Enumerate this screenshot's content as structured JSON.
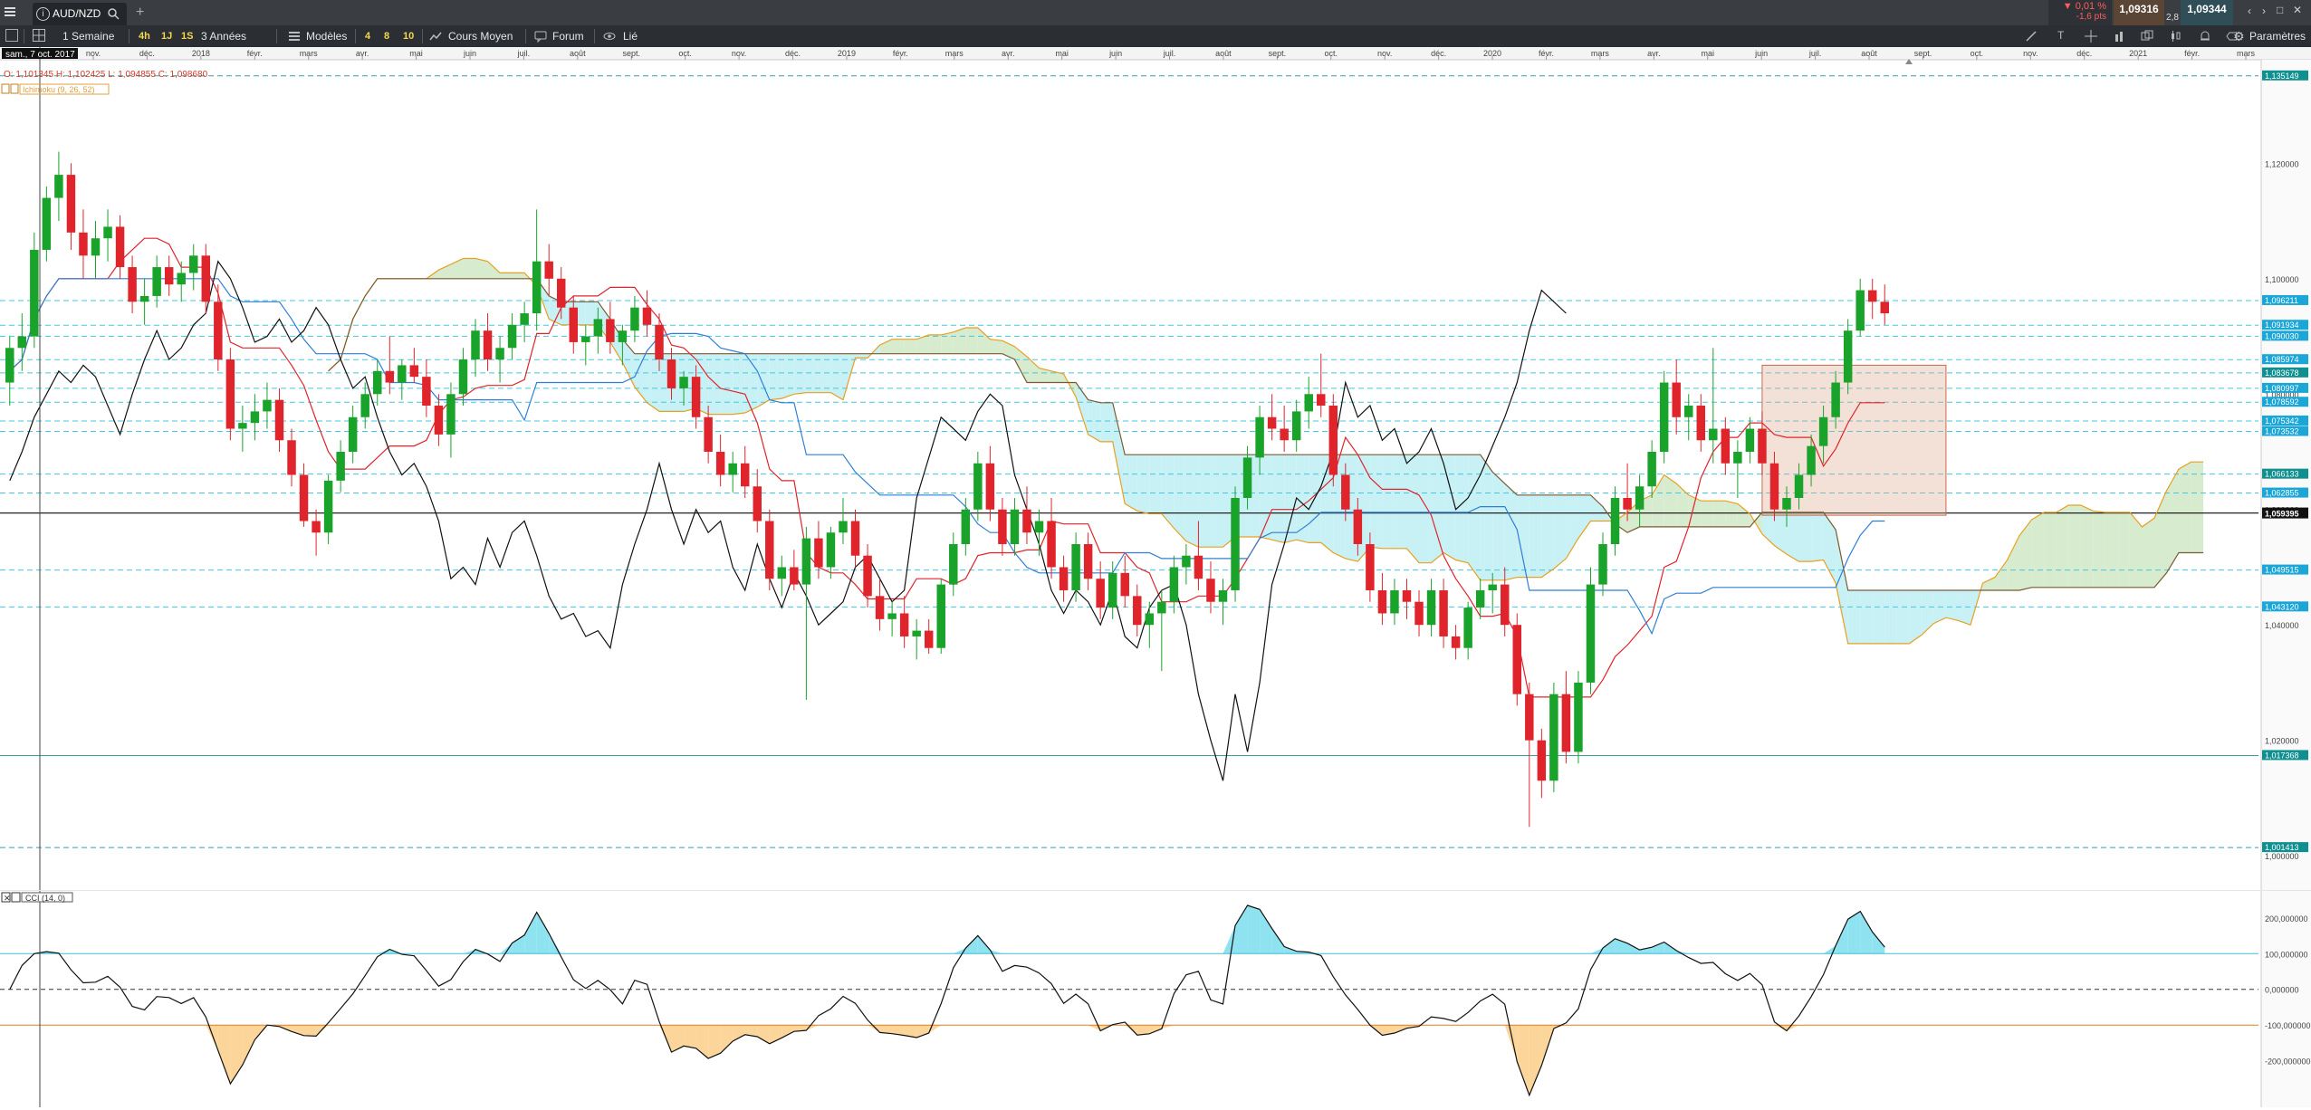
{
  "top_bar": {
    "symbol": "AUD/NZD",
    "new_tab": "+",
    "change_pct": "▼ 0,01 %",
    "change_pts": "-1,6 pts",
    "bid": "1,09316",
    "spread": "2,8",
    "ask": "1,09344",
    "window_controls": [
      "‹",
      "›",
      "□",
      "✕"
    ]
  },
  "toolbar": {
    "period": "1 Semaine",
    "quick_ranges": [
      "4h",
      "1J",
      "1S"
    ],
    "range": "3 Années",
    "models": "Modèles",
    "presets": [
      "4",
      "8",
      "10"
    ],
    "price_mode": "Cours Moyen",
    "forum": "Forum",
    "linked": "Lié",
    "settings": "Paramètres"
  },
  "time_axis": {
    "cursor_date": "sam., 7 oct. 2017",
    "labels": [
      "nov.",
      "déc.",
      "2018",
      "févr.",
      "mars",
      "avr.",
      "mai",
      "juin",
      "juil.",
      "août",
      "sept.",
      "oct.",
      "nov.",
      "déc.",
      "2019",
      "févr.",
      "mars",
      "avr.",
      "mai",
      "juin",
      "juil.",
      "août",
      "sept.",
      "oct.",
      "nov.",
      "déc.",
      "2020",
      "févr.",
      "mars",
      "avr.",
      "mai",
      "juin",
      "juil.",
      "août",
      "sept.",
      "oct.",
      "nov.",
      "déc.",
      "2021",
      "févr.",
      "mars"
    ]
  },
  "legend": {
    "ohlc": "O: 1,101345  H: 1,102425  L: 1,094855  C: 1,098680",
    "indicator": "Ichimoku (9, 26, 52)",
    "oscillator": "CCI (14, 0)"
  },
  "price_axis": {
    "ticks": [
      "1,120000",
      "1,100000",
      "1,080000",
      "1,060000",
      "1,040000",
      "1,020000",
      "1,000000"
    ],
    "current_price": "1,059395",
    "level_tags": [
      "1,135149",
      "1,096211",
      "1,091934",
      "1,090030",
      "1,085974",
      "1,083678",
      "1,080997",
      "1,078592",
      "1,075342",
      "1,073532",
      "1,066133",
      "1,062855",
      "1,049515",
      "1,043120",
      "1,017368",
      "1,001413"
    ],
    "level_tag_colors": [
      "#0f8f8f",
      "#1ba6d8",
      "#1ba6d8",
      "#1ba6d8",
      "#1ba6d8",
      "#0f8f8f",
      "#1ba6d8",
      "#1ba6d8",
      "#1ba6d8",
      "#1ba6d8",
      "#0f8f8f",
      "#1ba6d8",
      "#1ba6d8",
      "#1ba6d8",
      "#0f8f8f",
      "#0f8f8f"
    ]
  },
  "cci_axis": {
    "ticks": [
      "200,000000",
      "100,000000",
      "0,000000",
      "-100,000000",
      "-200,000000"
    ]
  },
  "chart_data": {
    "type": "candlestick",
    "symbol": "AUD/NZD",
    "interval": "1 Semaine",
    "ylim": [
      0.995,
      1.137
    ],
    "up_color": "#1aa32a",
    "down_color": "#e0242c",
    "candles": [
      [
        1.082,
        1.09,
        1.078,
        1.088
      ],
      [
        1.088,
        1.094,
        1.084,
        1.09
      ],
      [
        1.09,
        1.108,
        1.088,
        1.105
      ],
      [
        1.105,
        1.116,
        1.103,
        1.114
      ],
      [
        1.114,
        1.122,
        1.11,
        1.118
      ],
      [
        1.118,
        1.12,
        1.105,
        1.108
      ],
      [
        1.108,
        1.112,
        1.1,
        1.104
      ],
      [
        1.104,
        1.11,
        1.1,
        1.107
      ],
      [
        1.107,
        1.112,
        1.103,
        1.109
      ],
      [
        1.109,
        1.111,
        1.1,
        1.102
      ],
      [
        1.102,
        1.104,
        1.094,
        1.096
      ],
      [
        1.096,
        1.1,
        1.092,
        1.097
      ],
      [
        1.097,
        1.104,
        1.095,
        1.102
      ],
      [
        1.102,
        1.104,
        1.097,
        1.099
      ],
      [
        1.099,
        1.103,
        1.096,
        1.101
      ],
      [
        1.101,
        1.106,
        1.098,
        1.104
      ],
      [
        1.104,
        1.106,
        1.094,
        1.096
      ],
      [
        1.096,
        1.099,
        1.084,
        1.086
      ],
      [
        1.086,
        1.088,
        1.072,
        1.074
      ],
      [
        1.074,
        1.078,
        1.07,
        1.075
      ],
      [
        1.075,
        1.08,
        1.072,
        1.077
      ],
      [
        1.077,
        1.082,
        1.074,
        1.079
      ],
      [
        1.079,
        1.081,
        1.07,
        1.072
      ],
      [
        1.072,
        1.074,
        1.064,
        1.066
      ],
      [
        1.066,
        1.068,
        1.057,
        1.058
      ],
      [
        1.058,
        1.06,
        1.052,
        1.056
      ],
      [
        1.056,
        1.066,
        1.054,
        1.065
      ],
      [
        1.065,
        1.072,
        1.063,
        1.07
      ],
      [
        1.07,
        1.078,
        1.068,
        1.076
      ],
      [
        1.076,
        1.082,
        1.074,
        1.08
      ],
      [
        1.08,
        1.086,
        1.078,
        1.084
      ],
      [
        1.084,
        1.09,
        1.08,
        1.082
      ],
      [
        1.082,
        1.086,
        1.079,
        1.085
      ],
      [
        1.085,
        1.088,
        1.082,
        1.083
      ],
      [
        1.083,
        1.086,
        1.076,
        1.078
      ],
      [
        1.078,
        1.08,
        1.071,
        1.073
      ],
      [
        1.073,
        1.082,
        1.069,
        1.08
      ],
      [
        1.08,
        1.088,
        1.078,
        1.086
      ],
      [
        1.086,
        1.093,
        1.083,
        1.091
      ],
      [
        1.091,
        1.094,
        1.084,
        1.086
      ],
      [
        1.086,
        1.09,
        1.082,
        1.088
      ],
      [
        1.088,
        1.094,
        1.086,
        1.092
      ],
      [
        1.092,
        1.096,
        1.089,
        1.094
      ],
      [
        1.094,
        1.112,
        1.091,
        1.103
      ],
      [
        1.103,
        1.106,
        1.097,
        1.1
      ],
      [
        1.1,
        1.102,
        1.093,
        1.095
      ],
      [
        1.095,
        1.097,
        1.087,
        1.089
      ],
      [
        1.089,
        1.092,
        1.085,
        1.09
      ],
      [
        1.09,
        1.095,
        1.087,
        1.093
      ],
      [
        1.093,
        1.096,
        1.087,
        1.089
      ],
      [
        1.089,
        1.092,
        1.085,
        1.091
      ],
      [
        1.091,
        1.097,
        1.089,
        1.095
      ],
      [
        1.095,
        1.098,
        1.09,
        1.092
      ],
      [
        1.092,
        1.094,
        1.084,
        1.086
      ],
      [
        1.086,
        1.088,
        1.079,
        1.081
      ],
      [
        1.081,
        1.084,
        1.078,
        1.083
      ],
      [
        1.083,
        1.085,
        1.074,
        1.076
      ],
      [
        1.076,
        1.078,
        1.068,
        1.07
      ],
      [
        1.07,
        1.073,
        1.064,
        1.066
      ],
      [
        1.066,
        1.07,
        1.063,
        1.068
      ],
      [
        1.068,
        1.071,
        1.062,
        1.064
      ],
      [
        1.064,
        1.067,
        1.056,
        1.058
      ],
      [
        1.058,
        1.06,
        1.046,
        1.048
      ],
      [
        1.048,
        1.052,
        1.045,
        1.05
      ],
      [
        1.05,
        1.053,
        1.046,
        1.047
      ],
      [
        1.047,
        1.057,
        1.027,
        1.055
      ],
      [
        1.055,
        1.058,
        1.048,
        1.05
      ],
      [
        1.05,
        1.057,
        1.048,
        1.056
      ],
      [
        1.056,
        1.062,
        1.054,
        1.058
      ],
      [
        1.058,
        1.06,
        1.05,
        1.052
      ],
      [
        1.052,
        1.054,
        1.043,
        1.045
      ],
      [
        1.045,
        1.048,
        1.039,
        1.041
      ],
      [
        1.041,
        1.044,
        1.038,
        1.042
      ],
      [
        1.042,
        1.045,
        1.036,
        1.038
      ],
      [
        1.038,
        1.041,
        1.034,
        1.039
      ],
      [
        1.039,
        1.041,
        1.035,
        1.036
      ],
      [
        1.036,
        1.048,
        1.035,
        1.047
      ],
      [
        1.047,
        1.056,
        1.045,
        1.054
      ],
      [
        1.054,
        1.062,
        1.052,
        1.06
      ],
      [
        1.06,
        1.07,
        1.058,
        1.068
      ],
      [
        1.068,
        1.071,
        1.058,
        1.06
      ],
      [
        1.06,
        1.062,
        1.052,
        1.054
      ],
      [
        1.054,
        1.062,
        1.052,
        1.06
      ],
      [
        1.06,
        1.064,
        1.054,
        1.056
      ],
      [
        1.056,
        1.06,
        1.052,
        1.058
      ],
      [
        1.058,
        1.062,
        1.048,
        1.05
      ],
      [
        1.05,
        1.052,
        1.044,
        1.046
      ],
      [
        1.046,
        1.056,
        1.044,
        1.054
      ],
      [
        1.054,
        1.056,
        1.046,
        1.048
      ],
      [
        1.048,
        1.051,
        1.041,
        1.043
      ],
      [
        1.043,
        1.051,
        1.041,
        1.049
      ],
      [
        1.049,
        1.052,
        1.043,
        1.045
      ],
      [
        1.045,
        1.047,
        1.038,
        1.04
      ],
      [
        1.04,
        1.044,
        1.036,
        1.042
      ],
      [
        1.042,
        1.046,
        1.032,
        1.044
      ],
      [
        1.044,
        1.052,
        1.042,
        1.05
      ],
      [
        1.05,
        1.054,
        1.047,
        1.052
      ],
      [
        1.052,
        1.058,
        1.046,
        1.048
      ],
      [
        1.048,
        1.051,
        1.042,
        1.044
      ],
      [
        1.044,
        1.048,
        1.04,
        1.046
      ],
      [
        1.046,
        1.064,
        1.044,
        1.062
      ],
      [
        1.062,
        1.071,
        1.06,
        1.069
      ],
      [
        1.069,
        1.078,
        1.066,
        1.076
      ],
      [
        1.076,
        1.08,
        1.072,
        1.074
      ],
      [
        1.074,
        1.078,
        1.07,
        1.072
      ],
      [
        1.072,
        1.079,
        1.07,
        1.077
      ],
      [
        1.077,
        1.083,
        1.074,
        1.08
      ],
      [
        1.08,
        1.087,
        1.076,
        1.078
      ],
      [
        1.078,
        1.08,
        1.064,
        1.066
      ],
      [
        1.066,
        1.068,
        1.058,
        1.06
      ],
      [
        1.06,
        1.062,
        1.052,
        1.054
      ],
      [
        1.054,
        1.056,
        1.044,
        1.046
      ],
      [
        1.046,
        1.049,
        1.04,
        1.042
      ],
      [
        1.042,
        1.048,
        1.04,
        1.046
      ],
      [
        1.046,
        1.048,
        1.041,
        1.044
      ],
      [
        1.044,
        1.046,
        1.038,
        1.04
      ],
      [
        1.04,
        1.048,
        1.038,
        1.046
      ],
      [
        1.046,
        1.048,
        1.036,
        1.038
      ],
      [
        1.038,
        1.04,
        1.034,
        1.036
      ],
      [
        1.036,
        1.044,
        1.034,
        1.043
      ],
      [
        1.043,
        1.048,
        1.041,
        1.046
      ],
      [
        1.046,
        1.049,
        1.042,
        1.047
      ],
      [
        1.047,
        1.05,
        1.038,
        1.04
      ],
      [
        1.04,
        1.042,
        1.026,
        1.028
      ],
      [
        1.028,
        1.03,
        1.005,
        1.02
      ],
      [
        1.02,
        1.022,
        1.01,
        1.013
      ],
      [
        1.013,
        1.03,
        1.011,
        1.028
      ],
      [
        1.028,
        1.032,
        1.016,
        1.018
      ],
      [
        1.018,
        1.032,
        1.016,
        1.03
      ],
      [
        1.03,
        1.05,
        1.028,
        1.047
      ],
      [
        1.047,
        1.056,
        1.045,
        1.054
      ],
      [
        1.054,
        1.064,
        1.052,
        1.062
      ],
      [
        1.062,
        1.068,
        1.058,
        1.06
      ],
      [
        1.06,
        1.066,
        1.057,
        1.064
      ],
      [
        1.064,
        1.072,
        1.062,
        1.07
      ],
      [
        1.07,
        1.084,
        1.068,
        1.082
      ],
      [
        1.082,
        1.086,
        1.073,
        1.076
      ],
      [
        1.076,
        1.08,
        1.072,
        1.078
      ],
      [
        1.078,
        1.08,
        1.07,
        1.072
      ],
      [
        1.072,
        1.088,
        1.068,
        1.074
      ],
      [
        1.074,
        1.076,
        1.066,
        1.068
      ],
      [
        1.068,
        1.072,
        1.062,
        1.07
      ],
      [
        1.07,
        1.076,
        1.068,
        1.074
      ],
      [
        1.074,
        1.077,
        1.066,
        1.068
      ],
      [
        1.068,
        1.07,
        1.058,
        1.06
      ],
      [
        1.06,
        1.064,
        1.057,
        1.062
      ],
      [
        1.062,
        1.068,
        1.06,
        1.066
      ],
      [
        1.066,
        1.073,
        1.064,
        1.071
      ],
      [
        1.071,
        1.078,
        1.068,
        1.076
      ],
      [
        1.076,
        1.084,
        1.074,
        1.082
      ],
      [
        1.082,
        1.093,
        1.08,
        1.091
      ],
      [
        1.091,
        1.1,
        1.09,
        1.098
      ],
      [
        1.098,
        1.1,
        1.093,
        1.096
      ],
      [
        1.096,
        1.099,
        1.092,
        1.094
      ]
    ],
    "ichimoku": {
      "params": [
        9,
        26,
        52
      ],
      "tenkan_color": "#e0242c",
      "kijun_color": "#2f7fd6",
      "chikou_color": "#111111",
      "span_a_color": "#e8a020",
      "cloud_bull": "#d7ebce",
      "cloud_bear": "#c8f1f5"
    },
    "horizontal_levels": [
      1.135149,
      1.096211,
      1.091934,
      1.09003,
      1.085974,
      1.083678,
      1.080997,
      1.078592,
      1.075342,
      1.073532,
      1.066133,
      1.062855,
      1.049515,
      1.04312,
      1.017368,
      1.001413
    ],
    "rectangle": {
      "x_from": 143,
      "x_to": 158,
      "y_from": 1.059,
      "y_to": 1.085
    },
    "cci": {
      "params": [
        14,
        0
      ],
      "ylim": [
        -330,
        240
      ],
      "levels": [
        100,
        0,
        -100
      ]
    }
  }
}
